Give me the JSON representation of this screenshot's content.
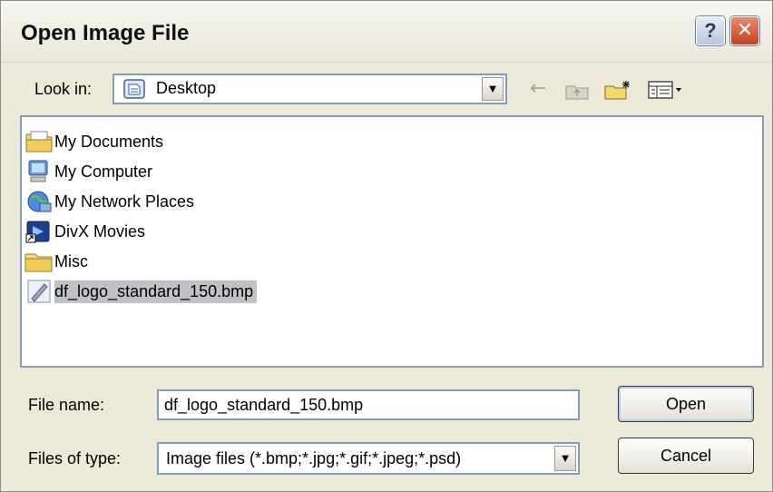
{
  "window": {
    "title": "Open Image File",
    "help_label": "?",
    "close_label": "✕"
  },
  "look_in": {
    "label": "Look in:",
    "value": "Desktop",
    "icon": "desktop-icon"
  },
  "toolbar": {
    "back_icon": "back-arrow-icon",
    "up_icon": "up-one-level-icon",
    "new_folder_icon": "new-folder-icon",
    "views_icon": "views-menu-icon"
  },
  "files": [
    {
      "name": "My Documents",
      "icon": "my-documents-icon",
      "selected": false
    },
    {
      "name": "My Computer",
      "icon": "my-computer-icon",
      "selected": false
    },
    {
      "name": "My Network Places",
      "icon": "network-places-icon",
      "selected": false
    },
    {
      "name": "DivX Movies",
      "icon": "shortcut-icon",
      "selected": false
    },
    {
      "name": "Misc",
      "icon": "folder-icon",
      "selected": false
    },
    {
      "name": "df_logo_standard_150.bmp",
      "icon": "bitmap-file-icon",
      "selected": true
    }
  ],
  "file_name": {
    "label": "File name:",
    "value": "df_logo_standard_150.bmp"
  },
  "file_type": {
    "label": "Files of type:",
    "value": "Image files (*.bmp;*.jpg;*.gif;*.jpeg;*.psd)"
  },
  "buttons": {
    "open": "Open",
    "cancel": "Cancel"
  }
}
